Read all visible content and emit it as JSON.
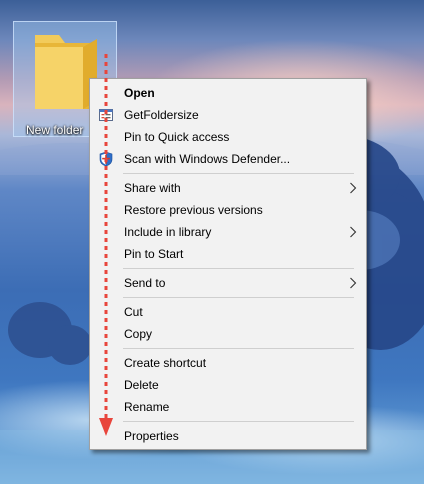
{
  "desktop": {
    "folder_label": "New folder",
    "folder_icon": "folder-icon",
    "folder_color": "#f6c94a"
  },
  "context_menu": {
    "items": [
      {
        "label": "Open",
        "bold": true
      },
      {
        "label": "GetFoldersize",
        "icon": "getfoldersize-icon"
      },
      {
        "label": "Pin to Quick access"
      },
      {
        "label": "Scan with Windows Defender...",
        "icon": "windows-defender-icon"
      },
      {
        "label": "Share with",
        "submenu": true
      },
      {
        "label": "Restore previous versions"
      },
      {
        "label": "Include in library",
        "submenu": true
      },
      {
        "label": "Pin to Start"
      },
      {
        "label": "Send to",
        "submenu": true
      },
      {
        "label": "Cut"
      },
      {
        "label": "Copy"
      },
      {
        "label": "Create shortcut"
      },
      {
        "label": "Delete"
      },
      {
        "label": "Rename"
      },
      {
        "label": "Properties"
      }
    ],
    "separators_after": [
      "Scan with Windows Defender...",
      "Pin to Start",
      "Send to",
      "Copy",
      "Rename"
    ]
  },
  "annotation": {
    "arrow": "red-dashed-down-arrow",
    "color": "#e8453c"
  }
}
